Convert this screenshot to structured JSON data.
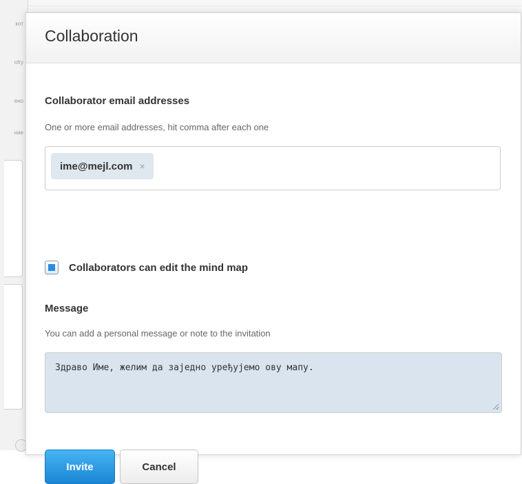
{
  "background": {
    "side_labels": [
      "кот",
      "ofry",
      "ено",
      "ние"
    ]
  },
  "dialog": {
    "title": "Collaboration",
    "collaborators": {
      "label": "Collaborator email addresses",
      "help": "One or more email addresses, hit comma after each one",
      "emails": [
        "ime@mejl.com"
      ],
      "remove_glyph": "×"
    },
    "edit_permission": {
      "label": "Collaborators can edit the mind map",
      "checked": true
    },
    "message": {
      "label": "Message",
      "help": "You can add a personal message or note to the invitation",
      "value": "Здраво Име, желим да заједно уређујемо ову мапу."
    },
    "buttons": {
      "invite": "Invite",
      "cancel": "Cancel"
    }
  },
  "colors": {
    "primary": "#2a8de4",
    "tag_bg": "#dfe7ef",
    "message_bg": "#d9e4ef"
  }
}
